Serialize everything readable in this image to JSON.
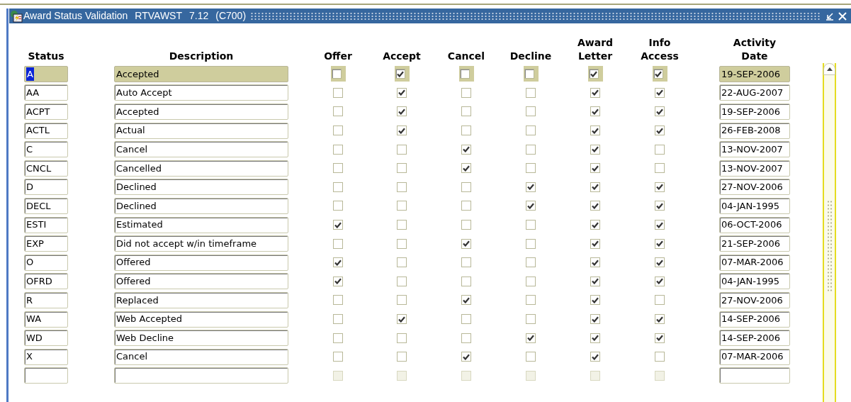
{
  "window": {
    "title": "Award Status Validation",
    "form": "RTVAWST",
    "version": "7.12",
    "instance": "(C700)"
  },
  "columns": {
    "status": "Status",
    "description": "Description",
    "flags": [
      [
        "Offer"
      ],
      [
        "Accept"
      ],
      [
        "Cancel"
      ],
      [
        "Decline"
      ],
      [
        "Award",
        "Letter"
      ],
      [
        "Info",
        "Access"
      ]
    ],
    "date": [
      "Activity",
      "Date"
    ]
  },
  "rows": [
    {
      "kind": "record",
      "selected": true,
      "status": "A",
      "description": "Accepted",
      "flags": [
        false,
        true,
        false,
        false,
        true,
        true
      ],
      "date": "19-SEP-2006"
    },
    {
      "kind": "record",
      "selected": false,
      "status": "AA",
      "description": "Auto Accept",
      "flags": [
        false,
        true,
        false,
        false,
        true,
        true
      ],
      "date": "22-AUG-2007"
    },
    {
      "kind": "record",
      "selected": false,
      "status": "ACPT",
      "description": "Accepted",
      "flags": [
        false,
        true,
        false,
        false,
        true,
        true
      ],
      "date": "19-SEP-2006"
    },
    {
      "kind": "record",
      "selected": false,
      "status": "ACTL",
      "description": "Actual",
      "flags": [
        false,
        true,
        false,
        false,
        true,
        true
      ],
      "date": "26-FEB-2008"
    },
    {
      "kind": "record",
      "selected": false,
      "status": "C",
      "description": "Cancel",
      "flags": [
        false,
        false,
        true,
        false,
        true,
        false
      ],
      "date": "13-NOV-2007"
    },
    {
      "kind": "record",
      "selected": false,
      "status": "CNCL",
      "description": "Cancelled",
      "flags": [
        false,
        false,
        true,
        false,
        true,
        false
      ],
      "date": "13-NOV-2007"
    },
    {
      "kind": "record",
      "selected": false,
      "status": "D",
      "description": "Declined",
      "flags": [
        false,
        false,
        false,
        true,
        true,
        true
      ],
      "date": "27-NOV-2006"
    },
    {
      "kind": "record",
      "selected": false,
      "status": "DECL",
      "description": "Declined",
      "flags": [
        false,
        false,
        false,
        true,
        true,
        true
      ],
      "date": "04-JAN-1995"
    },
    {
      "kind": "record",
      "selected": false,
      "status": "ESTI",
      "description": "Estimated",
      "flags": [
        true,
        false,
        false,
        false,
        true,
        true
      ],
      "date": "06-OCT-2006"
    },
    {
      "kind": "record",
      "selected": false,
      "status": "EXP",
      "description": "Did not accept w/in timeframe",
      "flags": [
        false,
        false,
        true,
        false,
        true,
        true
      ],
      "date": "21-SEP-2006"
    },
    {
      "kind": "record",
      "selected": false,
      "status": "O",
      "description": "Offered",
      "flags": [
        true,
        false,
        false,
        false,
        true,
        true
      ],
      "date": "07-MAR-2006"
    },
    {
      "kind": "record",
      "selected": false,
      "status": "OFRD",
      "description": "Offered",
      "flags": [
        true,
        false,
        false,
        false,
        true,
        true
      ],
      "date": "04-JAN-1995"
    },
    {
      "kind": "record",
      "selected": false,
      "status": "R",
      "description": "Replaced",
      "flags": [
        false,
        false,
        true,
        false,
        true,
        false
      ],
      "date": "27-NOV-2006"
    },
    {
      "kind": "record",
      "selected": false,
      "status": "WA",
      "description": "Web Accepted",
      "flags": [
        false,
        true,
        false,
        false,
        true,
        true
      ],
      "date": "14-SEP-2006"
    },
    {
      "kind": "record",
      "selected": false,
      "status": "WD",
      "description": "Web Decline",
      "flags": [
        false,
        false,
        false,
        true,
        true,
        true
      ],
      "date": "14-SEP-2006"
    },
    {
      "kind": "record",
      "selected": false,
      "status": "X",
      "description": "Cancel",
      "flags": [
        false,
        false,
        true,
        false,
        true,
        false
      ],
      "date": "07-MAR-2006"
    },
    {
      "kind": "blank",
      "disabled": true
    }
  ]
}
